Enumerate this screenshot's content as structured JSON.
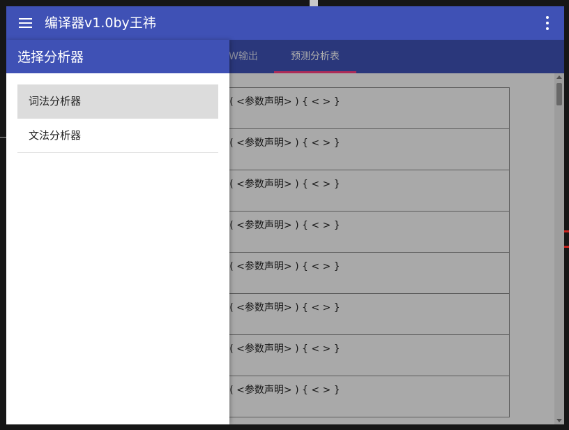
{
  "app": {
    "title": "编译器v1.0by王祎"
  },
  "tabs": [
    {
      "label": "W输出",
      "active": false
    },
    {
      "label": "预测分析表",
      "active": true
    }
  ],
  "table": {
    "rows": [
      "定义>-><修饰词闭包> <类型> <变量> ( <参数声明> ) { < > }",
      "定义>-><修饰词闭包> <类型> <变量> ( <参数声明> ) { < > }",
      "定义>-><修饰词闭包> <类型> <变量> ( <参数声明> ) { < > }",
      "定义>-><修饰词闭包> <类型> <变量> ( <参数声明> ) { < > }",
      "定义>-><修饰词闭包> <类型> <变量> ( <参数声明> ) { < > }",
      "定义>-><修饰词闭包> <类型> <变量> ( <参数声明> ) { < > }",
      "定义>-><修饰词闭包> <类型> <变量> ( <参数声明> ) { < > }",
      "定义>-><修饰词闭包> <类型> <变量> ( <参数声明> ) { < > }"
    ]
  },
  "drawer": {
    "title": "选择分析器",
    "items": [
      {
        "label": "词法分析器",
        "selected": true
      },
      {
        "label": "文法分析器",
        "selected": false
      }
    ]
  },
  "colors": {
    "primary": "#3f51b5",
    "tab_indicator": "#ff4081",
    "selected_item_bg": "#dcdcdc"
  },
  "icons": {
    "menu": "hamburger-menu-icon",
    "more": "more-vert-icon"
  }
}
